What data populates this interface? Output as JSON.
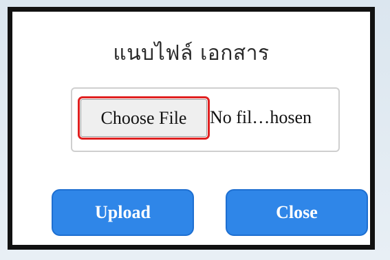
{
  "dialog": {
    "title": "แนบไฟล์ เอกสาร",
    "file_input": {
      "button_label": "Choose File",
      "status_text": "No fil…hosen"
    },
    "buttons": {
      "upload_label": "Upload",
      "close_label": "Close"
    }
  },
  "colors": {
    "button_blue": "#2f86e8",
    "highlight_red": "#e02020",
    "frame_black": "#111111"
  }
}
